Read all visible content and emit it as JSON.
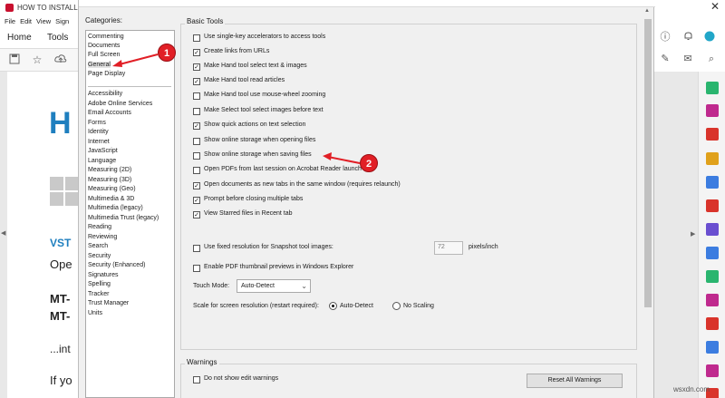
{
  "app": {
    "title": "HOW TO INSTALL A",
    "close_glyph": "✕",
    "menu": [
      "File",
      "Edit",
      "View",
      "Sign"
    ],
    "tabs": [
      "Home",
      "Tools"
    ]
  },
  "document": {
    "heading": "H",
    "section": "VST",
    "line1": "Ope",
    "mt1": "MT-",
    "mt2": "MT-",
    "ellipsis_line": "...int",
    "if_line": "If yo"
  },
  "dialog": {
    "categories_label": "Categories:",
    "categories_top": [
      "Commenting",
      "Documents",
      "Full Screen",
      "General",
      "Page Display"
    ],
    "categories_rest": [
      "Accessibility",
      "Adobe Online Services",
      "Email Accounts",
      "Forms",
      "Identity",
      "Internet",
      "JavaScript",
      "Language",
      "Measuring (2D)",
      "Measuring (3D)",
      "Measuring (Geo)",
      "Multimedia & 3D",
      "Multimedia (legacy)",
      "Multimedia Trust (legacy)",
      "Reading",
      "Reviewing",
      "Search",
      "Security",
      "Security (Enhanced)",
      "Signatures",
      "Spelling",
      "Tracker",
      "Trust Manager",
      "Units"
    ],
    "selected_category": "General",
    "basic_tools_title": "Basic Tools",
    "options": [
      {
        "label": "Use single-key accelerators to access tools",
        "checked": false
      },
      {
        "label": "Create links from URLs",
        "checked": true
      },
      {
        "label": "Make Hand tool select text & images",
        "checked": true
      },
      {
        "label": "Make Hand tool read articles",
        "checked": true
      },
      {
        "label": "Make Hand tool use mouse-wheel zooming",
        "checked": false
      },
      {
        "label": "Make Select tool select images before text",
        "checked": false
      },
      {
        "label": "Show quick actions on text selection",
        "checked": true
      },
      {
        "label": "Show online storage when opening files",
        "checked": false
      },
      {
        "label": "Show online storage when saving files",
        "checked": false
      },
      {
        "label": "Open PDFs from last session on Acrobat Reader launch",
        "checked": false
      },
      {
        "label": "Open documents as new tabs in the same window (requires relaunch)",
        "checked": true
      },
      {
        "label": "Prompt before closing multiple tabs",
        "checked": true
      },
      {
        "label": "View Starred files in Recent tab",
        "checked": true
      }
    ],
    "snapshot": {
      "label": "Use fixed resolution for Snapshot tool images:",
      "checked": false,
      "value": "72",
      "unit": "pixels/inch"
    },
    "thumbnail": {
      "label": "Enable PDF thumbnail previews in Windows Explorer",
      "checked": false
    },
    "touch_mode": {
      "label": "Touch Mode:",
      "value": "Auto-Detect"
    },
    "scale": {
      "label": "Scale for screen resolution (restart required):",
      "options": [
        "Auto-Detect",
        "No Scaling"
      ],
      "selected": "Auto-Detect"
    },
    "warnings": {
      "title": "Warnings",
      "checkbox_label": "Do not show edit warnings",
      "checked": false,
      "reset_button": "Reset All Warnings"
    }
  },
  "annotations": {
    "badge1": "1",
    "badge2": "2",
    "color": "#e11f26"
  },
  "watermark": "wsxdn.com"
}
